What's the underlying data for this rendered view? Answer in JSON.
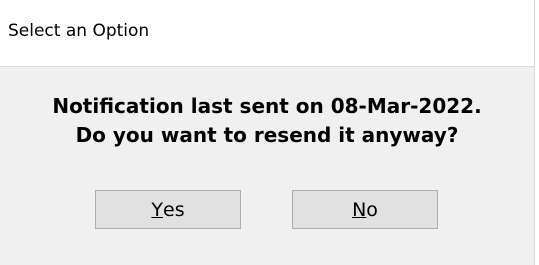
{
  "window": {
    "title": "Select an Option"
  },
  "message": {
    "line1": "Notification last sent on 08-Mar-2022.",
    "line2": "Do you want to resend it anyway?"
  },
  "buttons": {
    "yes": {
      "label": "Yes",
      "accelerator": "Y",
      "rest": "es"
    },
    "no": {
      "label": "No",
      "accelerator": "N",
      "rest": "o"
    }
  },
  "colors": {
    "dialog_background": "#f0f0f0",
    "title_background": "#ffffff",
    "button_background": "#e1e1e1",
    "button_border": "#adadad"
  }
}
